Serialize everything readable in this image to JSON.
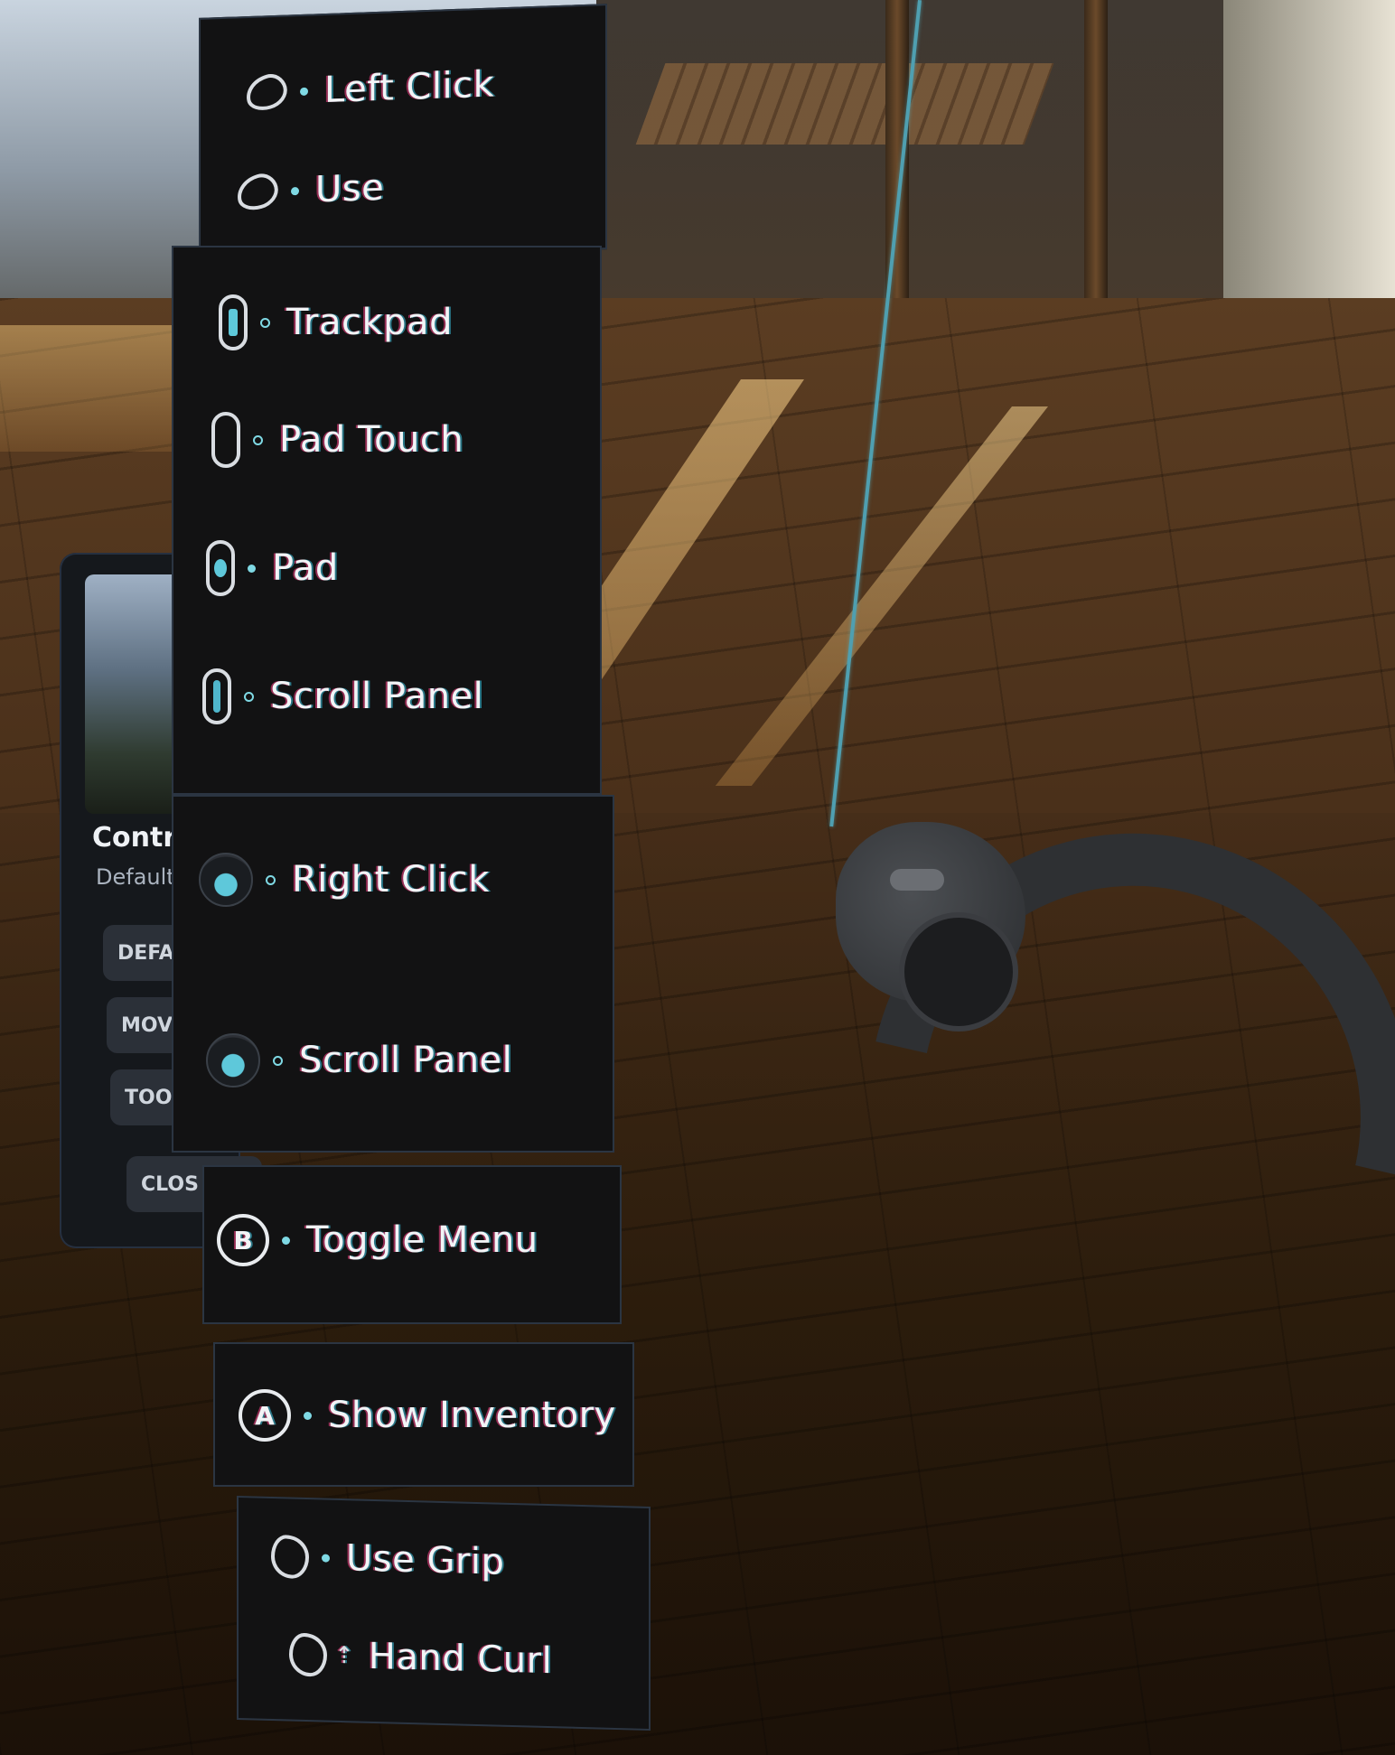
{
  "background_menu": {
    "title": "Contr",
    "subtitle": "Default",
    "buttons": [
      "DEFAU",
      "MOVI",
      "TOOL",
      "CLOS"
    ]
  },
  "panels": [
    {
      "rows": [
        {
          "icon": "trigger-icon",
          "dot": "filled",
          "label": "Left Click"
        },
        {
          "icon": "trigger-icon",
          "dot": "filled",
          "label": "Use"
        }
      ]
    },
    {
      "rows": [
        {
          "icon": "trackpad-icon",
          "dot": "hollow",
          "label": "Trackpad"
        },
        {
          "icon": "trackpad-touch-icon",
          "dot": "hollow",
          "label": "Pad Touch"
        },
        {
          "icon": "trackpad-press-icon",
          "dot": "filled",
          "label": "Pad"
        },
        {
          "icon": "trackpad-scroll-icon",
          "dot": "hollow",
          "label": "Scroll Panel"
        }
      ]
    },
    {
      "rows": [
        {
          "icon": "thumbstick-click-icon",
          "dot": "hollow",
          "label": "Right Click"
        },
        {
          "icon": "thumbstick-icon",
          "dot": "hollow",
          "label": "Scroll Panel"
        }
      ]
    },
    {
      "rows": [
        {
          "icon": "b-button-icon",
          "glyph": "B",
          "dot": "filled",
          "label": "Toggle Menu"
        }
      ]
    },
    {
      "rows": [
        {
          "icon": "a-button-icon",
          "glyph": "A",
          "dot": "filled",
          "label": "Show Inventory"
        }
      ]
    },
    {
      "rows": [
        {
          "icon": "grip-icon",
          "dot": "filled",
          "label": "Use Grip"
        },
        {
          "icon": "grip-curl-icon",
          "arrows": "⇡",
          "label": "Hand Curl"
        }
      ]
    }
  ],
  "colors": {
    "panel_bg": "#121213",
    "accent": "#7fd9e4",
    "laser": "#4f9fb0",
    "text": "#f2f4f6"
  }
}
